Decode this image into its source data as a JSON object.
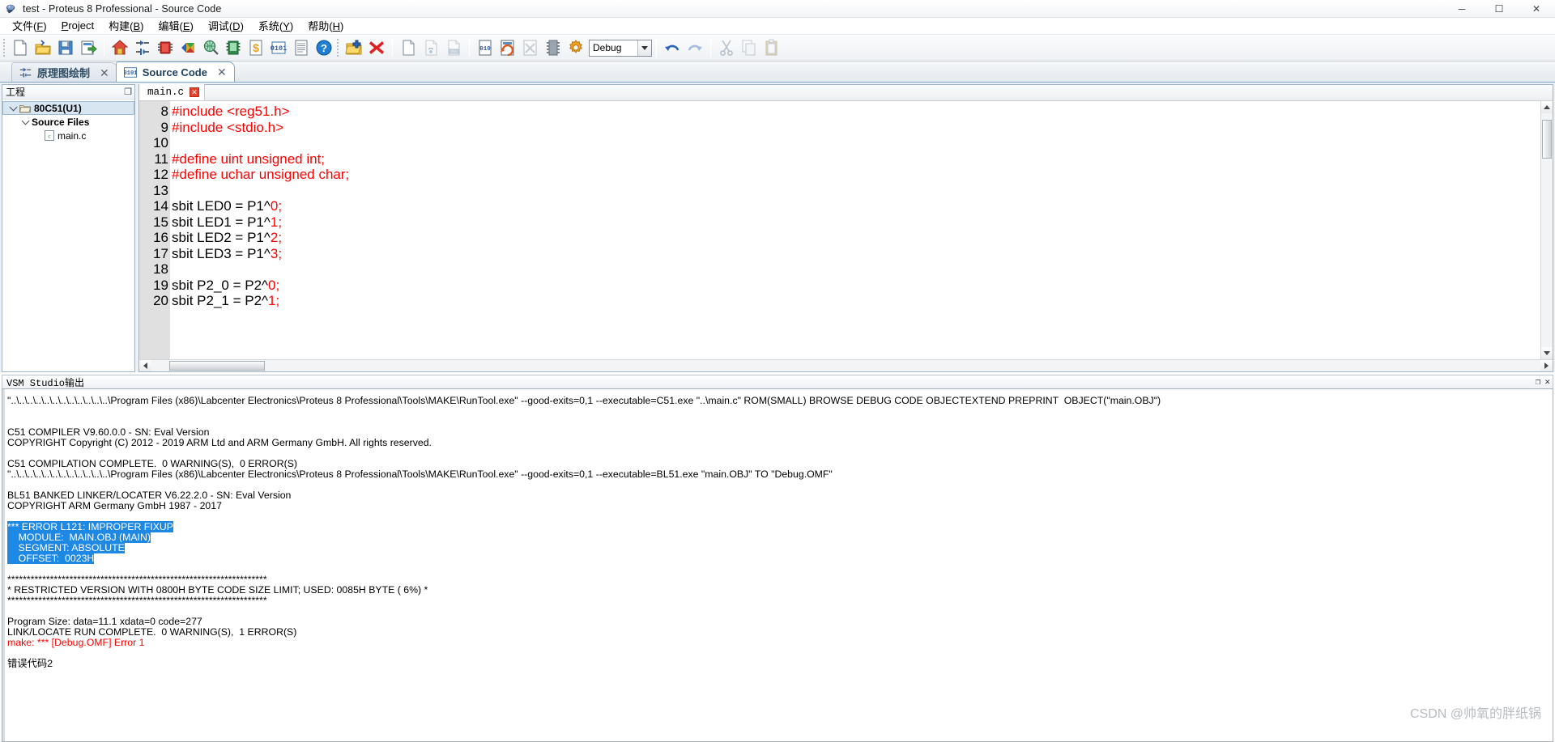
{
  "window": {
    "title": "test - Proteus 8 Professional - Source Code",
    "minimize_label": "─",
    "maximize_label": "☐",
    "close_label": "✕"
  },
  "menubar": {
    "items": [
      {
        "name": "file",
        "pre": "文件(",
        "key": "F",
        "post": ")"
      },
      {
        "name": "project",
        "pre": "",
        "key": "P",
        "post": "roject"
      },
      {
        "name": "build",
        "pre": "构建(",
        "key": "B",
        "post": ")"
      },
      {
        "name": "edit",
        "pre": "编辑(",
        "key": "E",
        "post": ")"
      },
      {
        "name": "debug",
        "pre": "调试(",
        "key": "D",
        "post": ")"
      },
      {
        "name": "system",
        "pre": "系统(",
        "key": "Y",
        "post": ")"
      },
      {
        "name": "help",
        "pre": "帮助(",
        "key": "H",
        "post": ")"
      }
    ]
  },
  "toolbar": {
    "build_config_value": "Debug",
    "icons": [
      "new-project-icon",
      "open-project-icon",
      "save-project-icon",
      "import-project-icon",
      "home-icon",
      "schematic-capture-icon",
      "pcb-layout-icon",
      "3d-viewer-icon",
      "bill-of-materials-icon",
      "design-explorer-icon",
      "bom-cost-icon",
      "source-code-icon",
      "report-icon",
      "help-icon",
      "add-files-icon",
      "remove-files-icon",
      "new-file-icon",
      "open-file-icon",
      "print-file-icon",
      "project-settings-icon",
      "rebuild-icon",
      "clean-icon",
      "chip-icon",
      "gear-icon",
      "undo-icon",
      "redo-icon",
      "cut-icon",
      "copy-icon",
      "paste-icon"
    ]
  },
  "tabs": [
    {
      "name": "tab-schematic-capture",
      "label": "原理图绘制",
      "icon": "schematic-icon",
      "close": "✕",
      "active": false
    },
    {
      "name": "tab-source-code",
      "label": "Source Code",
      "icon": "source-code-icon",
      "close": "✕",
      "active": true
    }
  ],
  "project_panel": {
    "title": "工程",
    "float_icon": "❐",
    "tree": [
      {
        "label": "80C51(U1)",
        "icon": "folder-icon",
        "depth": 0,
        "expanded": true,
        "selected": true,
        "bold": true
      },
      {
        "label": "Source Files",
        "icon": "",
        "depth": 1,
        "expanded": true,
        "selected": false,
        "bold": true
      },
      {
        "label": "main.c",
        "icon": "c-file-icon",
        "depth": 2,
        "expanded": false,
        "selected": false,
        "bold": false
      }
    ]
  },
  "editor": {
    "doc_tab": {
      "label": "main.c",
      "close": "✕"
    },
    "first_line_number": 8,
    "lines": [
      {
        "n": 8,
        "tokens": [
          {
            "t": "#include <reg51.h>",
            "c": "pre"
          }
        ]
      },
      {
        "n": 9,
        "tokens": [
          {
            "t": "#include <stdio.h>",
            "c": "pre"
          }
        ]
      },
      {
        "n": 10,
        "tokens": []
      },
      {
        "n": 11,
        "tokens": [
          {
            "t": "#define uint unsigned int;",
            "c": "pre"
          }
        ]
      },
      {
        "n": 12,
        "tokens": [
          {
            "t": "#define uchar unsigned char;",
            "c": "pre"
          }
        ]
      },
      {
        "n": 13,
        "tokens": []
      },
      {
        "n": 14,
        "tokens": [
          {
            "t": "sbit LED0 = P1^",
            "c": "txt"
          },
          {
            "t": "0;",
            "c": "num"
          }
        ]
      },
      {
        "n": 15,
        "tokens": [
          {
            "t": "sbit LED1 = P1^",
            "c": "txt"
          },
          {
            "t": "1;",
            "c": "num"
          }
        ]
      },
      {
        "n": 16,
        "tokens": [
          {
            "t": "sbit LED2 = P1^",
            "c": "txt"
          },
          {
            "t": "2;",
            "c": "num"
          }
        ]
      },
      {
        "n": 17,
        "tokens": [
          {
            "t": "sbit LED3 = P1^",
            "c": "txt"
          },
          {
            "t": "3;",
            "c": "num"
          }
        ]
      },
      {
        "n": 18,
        "tokens": []
      },
      {
        "n": 19,
        "tokens": [
          {
            "t": "sbit P2_0 = P2^",
            "c": "txt"
          },
          {
            "t": "0;",
            "c": "num"
          }
        ]
      },
      {
        "n": 20,
        "tokens": [
          {
            "t": "sbit P2_1 = P2^",
            "c": "txt"
          },
          {
            "t": "1;",
            "c": "num"
          }
        ]
      }
    ]
  },
  "output_panel": {
    "title": "VSM Studio输出",
    "float_icon": "❐",
    "close_icon": "✕",
    "lines": [
      {
        "t": "\"..\\..\\..\\..\\..\\..\\..\\..\\..\\..\\..\\..\\Program Files (x86)\\Labcenter Electronics\\Proteus 8 Professional\\Tools\\MAKE\\RunTool.exe\" --good-exits=0,1 --executable=C51.exe \"..\\main.c\" ROM(SMALL) BROWSE DEBUG CODE OBJECTEXTEND PREPRINT  OBJECT(\"main.OBJ\")",
        "s": "normal"
      },
      {
        "t": "",
        "s": "normal"
      },
      {
        "t": "",
        "s": "normal"
      },
      {
        "t": "C51 COMPILER V9.60.0.0 - SN: Eval Version",
        "s": "normal"
      },
      {
        "t": "COPYRIGHT Copyright (C) 2012 - 2019 ARM Ltd and ARM Germany GmbH. All rights reserved.",
        "s": "normal"
      },
      {
        "t": "",
        "s": "normal"
      },
      {
        "t": "C51 COMPILATION COMPLETE.  0 WARNING(S),  0 ERROR(S)",
        "s": "normal"
      },
      {
        "t": "\"..\\..\\..\\..\\..\\..\\..\\..\\..\\..\\..\\..\\Program Files (x86)\\Labcenter Electronics\\Proteus 8 Professional\\Tools\\MAKE\\RunTool.exe\" --good-exits=0,1 --executable=BL51.exe \"main.OBJ\" TO \"Debug.OMF\"",
        "s": "normal"
      },
      {
        "t": "",
        "s": "normal"
      },
      {
        "t": "BL51 BANKED LINKER/LOCATER V6.22.2.0 - SN: Eval Version",
        "s": "normal"
      },
      {
        "t": "COPYRIGHT ARM Germany GmbH 1987 - 2017",
        "s": "normal"
      },
      {
        "t": "",
        "s": "normal"
      },
      {
        "t": "*** ERROR L121: IMPROPER FIXUP",
        "s": "highlight"
      },
      {
        "t": "    MODULE:  MAIN.OBJ (MAIN)",
        "s": "highlight"
      },
      {
        "t": "    SEGMENT: ABSOLUTE",
        "s": "highlight"
      },
      {
        "t": "    OFFSET:  0023H",
        "s": "highlight"
      },
      {
        "t": "",
        "s": "normal"
      },
      {
        "t": "*******************************************************************",
        "s": "normal"
      },
      {
        "t": "* RESTRICTED VERSION WITH 0800H BYTE CODE SIZE LIMIT; USED: 0085H BYTE ( 6%) *",
        "s": "normal"
      },
      {
        "t": "*******************************************************************",
        "s": "normal"
      },
      {
        "t": "",
        "s": "normal"
      },
      {
        "t": "Program Size: data=11.1 xdata=0 code=277",
        "s": "normal"
      },
      {
        "t": "LINK/LOCATE RUN COMPLETE.  0 WARNING(S),  1 ERROR(S)",
        "s": "normal"
      },
      {
        "t": "make: *** [Debug.OMF] Error 1",
        "s": "error"
      },
      {
        "t": "",
        "s": "normal"
      },
      {
        "t": "错误代码2",
        "s": "normal"
      }
    ]
  },
  "watermark": {
    "text": "CSDN @帅氧的胖纸锅"
  },
  "colors": {
    "preprocessor": "#ff0000",
    "code_text": "#000000",
    "highlight_bg": "#1e88e5",
    "error_text": "#ff0000",
    "gutter_bg": "#e0e0e0",
    "tab_active_border": "#7ba7c9"
  }
}
